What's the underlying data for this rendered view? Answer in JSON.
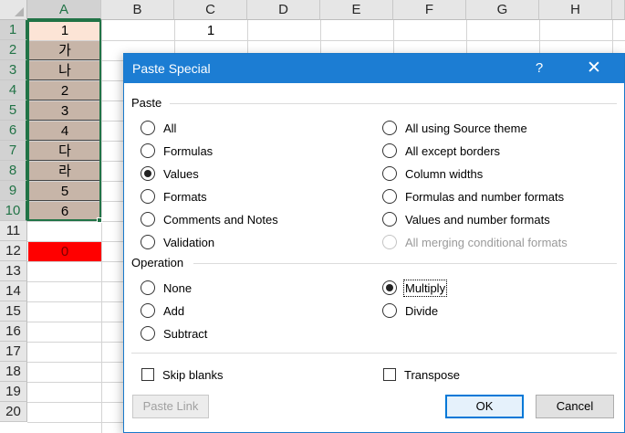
{
  "spreadsheet": {
    "columns": [
      "A",
      "B",
      "C",
      "D",
      "E",
      "F",
      "G",
      "H"
    ],
    "rows": [
      "1",
      "2",
      "3",
      "4",
      "5",
      "6",
      "7",
      "8",
      "9",
      "10",
      "11",
      "12",
      "13",
      "14",
      "15",
      "16",
      "17",
      "18",
      "19",
      "20"
    ],
    "cells": {
      "A1": "1",
      "A2": "가",
      "A3": "나",
      "A4": "2",
      "A5": "3",
      "A6": "4",
      "A7": "다",
      "A8": "라",
      "A9": "5",
      "A10": "6",
      "A12": "0",
      "C1": "1"
    },
    "colors": {
      "a1_fill": "#fce4d6",
      "range_fill": "#c7b5a8",
      "a12_fill": "#ff0000",
      "selection": "#217346"
    }
  },
  "dialog": {
    "title": "Paste Special",
    "help_label": "?",
    "close_label": "✕",
    "paste_group": {
      "label": "Paste",
      "options": [
        {
          "label": "All",
          "checked": false,
          "disabled": false
        },
        {
          "label": "Formulas",
          "checked": false,
          "disabled": false
        },
        {
          "label": "Values",
          "checked": true,
          "disabled": false
        },
        {
          "label": "Formats",
          "checked": false,
          "disabled": false
        },
        {
          "label": "Comments and Notes",
          "checked": false,
          "disabled": false
        },
        {
          "label": "Validation",
          "checked": false,
          "disabled": false
        },
        {
          "label": "All using Source theme",
          "checked": false,
          "disabled": false
        },
        {
          "label": "All except borders",
          "checked": false,
          "disabled": false
        },
        {
          "label": "Column widths",
          "checked": false,
          "disabled": false
        },
        {
          "label": "Formulas and number formats",
          "checked": false,
          "disabled": false
        },
        {
          "label": "Values and number formats",
          "checked": false,
          "disabled": false
        },
        {
          "label": "All merging conditional formats",
          "checked": false,
          "disabled": true
        }
      ]
    },
    "operation_group": {
      "label": "Operation",
      "options": [
        {
          "label": "None",
          "checked": false
        },
        {
          "label": "Add",
          "checked": false
        },
        {
          "label": "Subtract",
          "checked": false
        },
        {
          "label": "Multiply",
          "checked": true
        },
        {
          "label": "Divide",
          "checked": false
        }
      ]
    },
    "skip_blanks": {
      "label": "Skip blanks",
      "checked": false
    },
    "transpose": {
      "label": "Transpose",
      "checked": false
    },
    "buttons": {
      "paste_link": "Paste Link",
      "ok": "OK",
      "cancel": "Cancel"
    },
    "colors": {
      "titlebar": "#1c7dd3",
      "default_button": "#0078d7"
    }
  }
}
